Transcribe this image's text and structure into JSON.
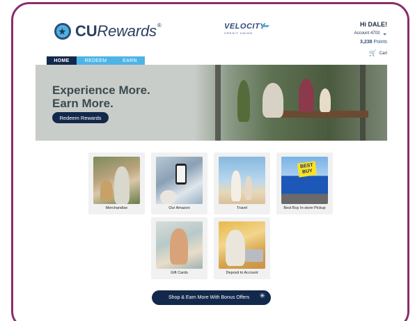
{
  "header": {
    "logo_cu": "CU",
    "logo_rewards": "Rewards",
    "logo_reg": "®",
    "partner_name": "VELOCITY",
    "partner_sub": "CREDIT UNION",
    "greeting": "Hi DALE!",
    "account": "Account 4703",
    "points_value": "3,238",
    "points_label": "Points",
    "cart_label": "Cart"
  },
  "tabs": [
    {
      "label": "HOME",
      "active": true
    },
    {
      "label": "REDEEM",
      "active": false
    },
    {
      "label": "EARN",
      "active": false
    }
  ],
  "hero": {
    "line1": "Experience More.",
    "line2": "Earn More.",
    "button": "Redeem Rewards"
  },
  "cards": [
    {
      "label": "Merchandise"
    },
    {
      "label": "Our Amazon"
    },
    {
      "label": "Travel"
    },
    {
      "label": "Best Buy In-store Pickup"
    },
    {
      "label": "Gift Cards"
    },
    {
      "label": "Deposit to Account"
    }
  ],
  "bestbuy_sign": "BEST BUY",
  "bonus_button": "Shop & Earn More With Bonus Offers",
  "colors": {
    "frame": "#8a2c6e",
    "navy": "#13294b",
    "tab_light": "#4db4e6"
  },
  "icons": [
    "star-logo-icon",
    "chevron-down-icon",
    "cart-icon",
    "sparkle-icon"
  ]
}
